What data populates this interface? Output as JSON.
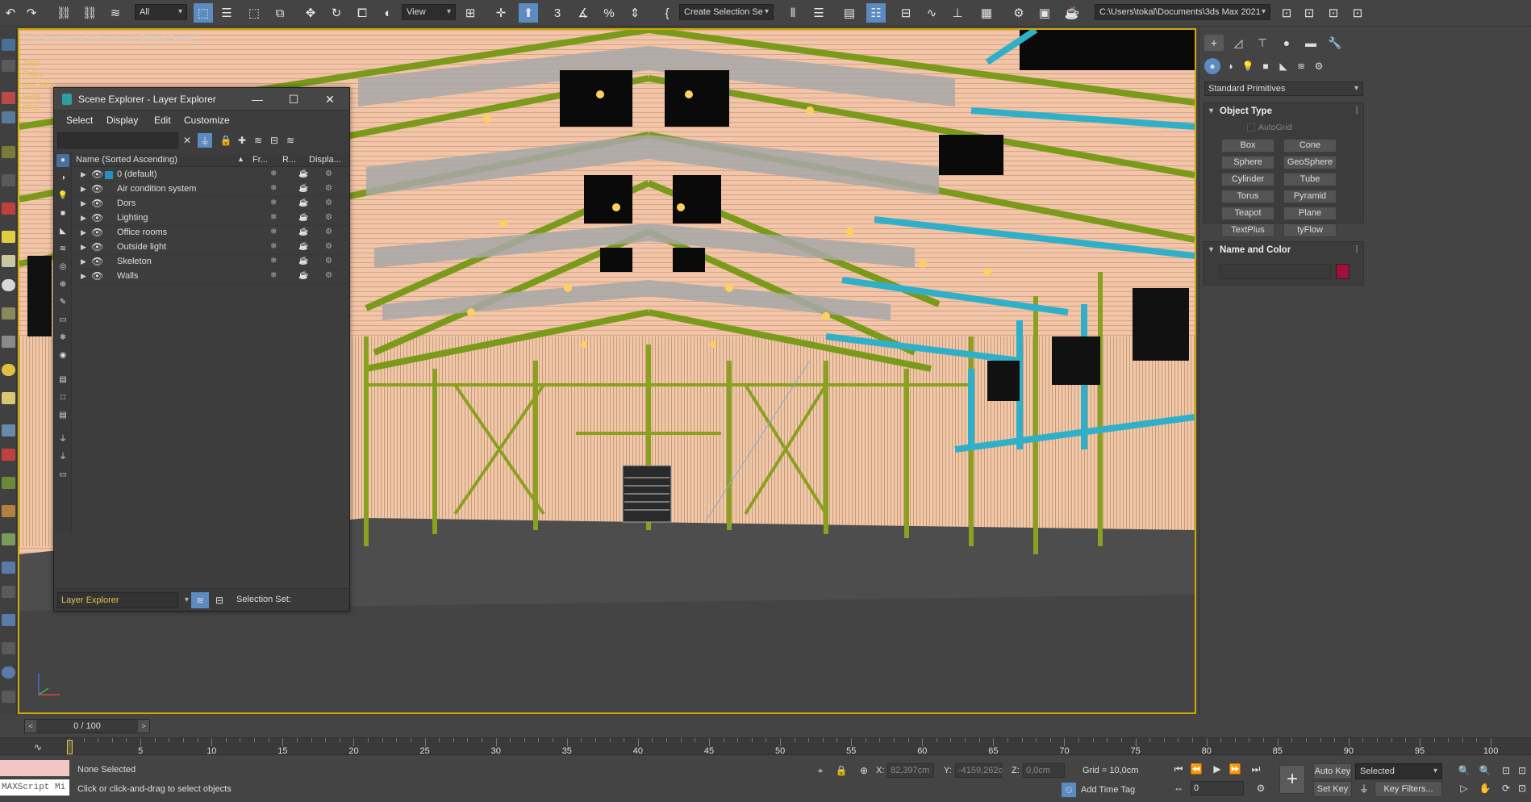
{
  "toolbar": {
    "selection_filter": "All",
    "ref_coord": "View",
    "named_selection": "Create Selection Se",
    "project_path": "C:\\Users\\tokal\\Documents\\3ds Max 2021",
    "icons": [
      "undo-icon",
      "redo-icon",
      "link-icon",
      "unlink-icon",
      "bind-space-warp-icon",
      "select-object-icon",
      "select-by-name-icon",
      "rect-region-icon",
      "window-crossing-icon",
      "move-icon",
      "rotate-icon",
      "scale-icon",
      "placement-icon",
      "pivot-icon",
      "snaps-toggle-icon",
      "angle-snap-icon",
      "percent-snap-icon",
      "spinner-snap-icon",
      "edit-named-sets-icon",
      "mirror-icon",
      "align-icon",
      "layer-explorer-icon",
      "scene-explorer-icon",
      "ribbon-icon",
      "curve-editor-icon",
      "schematic-icon",
      "material-editor-icon",
      "render-setup-icon",
      "rendered-frame-icon",
      "render-icon"
    ]
  },
  "viewport": {
    "label": "[+] [Perspective ] [Standard ] [Edged Faces ]",
    "stats": [
      "Total",
      "Polys: 655.289",
      "Verts:",
      "FPS:"
    ]
  },
  "scene_explorer": {
    "title": "Scene Explorer - Layer Explorer",
    "menus": [
      "Select",
      "Display",
      "Edit",
      "Customize"
    ],
    "columns": {
      "name": "Name (Sorted Ascending)",
      "freeze": "Fr...",
      "render": "R...",
      "display": "Displa..."
    },
    "layers": [
      "0 (default)",
      "Air condition system",
      "Dors",
      "Lighting",
      "Office rooms",
      "Outside light",
      "Skeleton",
      "Walls"
    ],
    "footer_dropdown": "Layer Explorer",
    "selection_set_label": "Selection Set:"
  },
  "command_panel": {
    "dropdown": "Standard Primitives",
    "object_type": {
      "header": "Object Type",
      "autogrid": "AutoGrid",
      "buttons": [
        "Box",
        "Cone",
        "Sphere",
        "GeoSphere",
        "Cylinder",
        "Tube",
        "Torus",
        "Pyramid",
        "Teapot",
        "Plane",
        "TextPlus",
        "tyFlow"
      ]
    },
    "name_and_color": {
      "header": "Name and Color",
      "color": "#a01038"
    }
  },
  "timeline": {
    "frame_slider": "0 / 100",
    "ticks": [
      "5",
      "10",
      "15",
      "20",
      "25",
      "30",
      "35",
      "40",
      "45",
      "50",
      "55",
      "60",
      "65",
      "70",
      "75",
      "80",
      "85",
      "90",
      "95",
      "100"
    ]
  },
  "status_bar": {
    "maxscript": "MAXScript Mi",
    "selection_status": "None Selected",
    "prompt": "Click or click-and-drag to select objects",
    "x_label": "X:",
    "x_value": "82,397cm",
    "y_label": "Y:",
    "y_value": "-4159,262c",
    "z_label": "Z:",
    "z_value": "0,0cm",
    "grid": "Grid = 10,0cm",
    "add_time_tag": "Add Time Tag",
    "auto_key": "Auto Key",
    "set_key": "Set Key",
    "key_filter_dropdown": "Selected",
    "key_filters": "Key Filters...",
    "current_frame": "0"
  }
}
